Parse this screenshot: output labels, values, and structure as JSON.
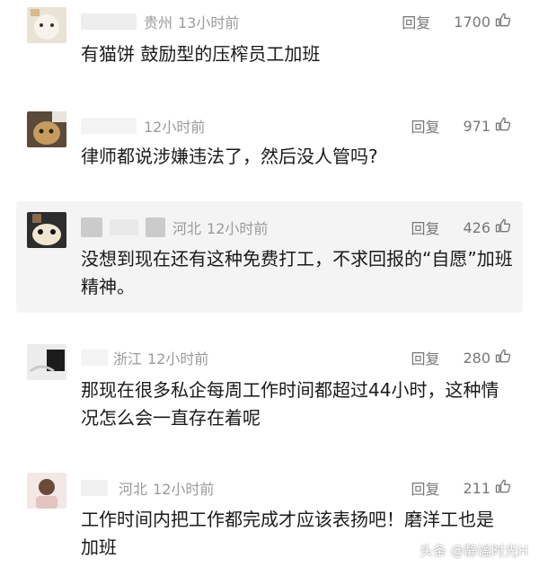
{
  "comments": [
    {
      "location": "贵州",
      "time": "13小时前",
      "reply_label": "回复",
      "likes": "1700",
      "text": "有猫饼  鼓励型的压榨员工加班"
    },
    {
      "location": "",
      "time": "12小时前",
      "reply_label": "回复",
      "likes": "971",
      "text": "律师都说涉嫌违法了，然后没人管吗?"
    },
    {
      "location": "河北",
      "time": "12小时前",
      "reply_label": "回复",
      "likes": "426",
      "text": "没想到现在还有这种免费打工，不求回报的“自愿”加班精神。"
    },
    {
      "location": "浙江",
      "time": "12小时前",
      "reply_label": "回复",
      "likes": "280",
      "text": "那现在很多私企每周工作时间都超过44小时，这种情况怎么会一直存在着呢"
    },
    {
      "location": "河北",
      "time": "12小时前",
      "reply_label": "回复",
      "likes": "211",
      "text": "工作时间内把工作都完成才应该表扬吧！磨洋工也是加班"
    }
  ],
  "watermark": "头条 @静谧时光H"
}
